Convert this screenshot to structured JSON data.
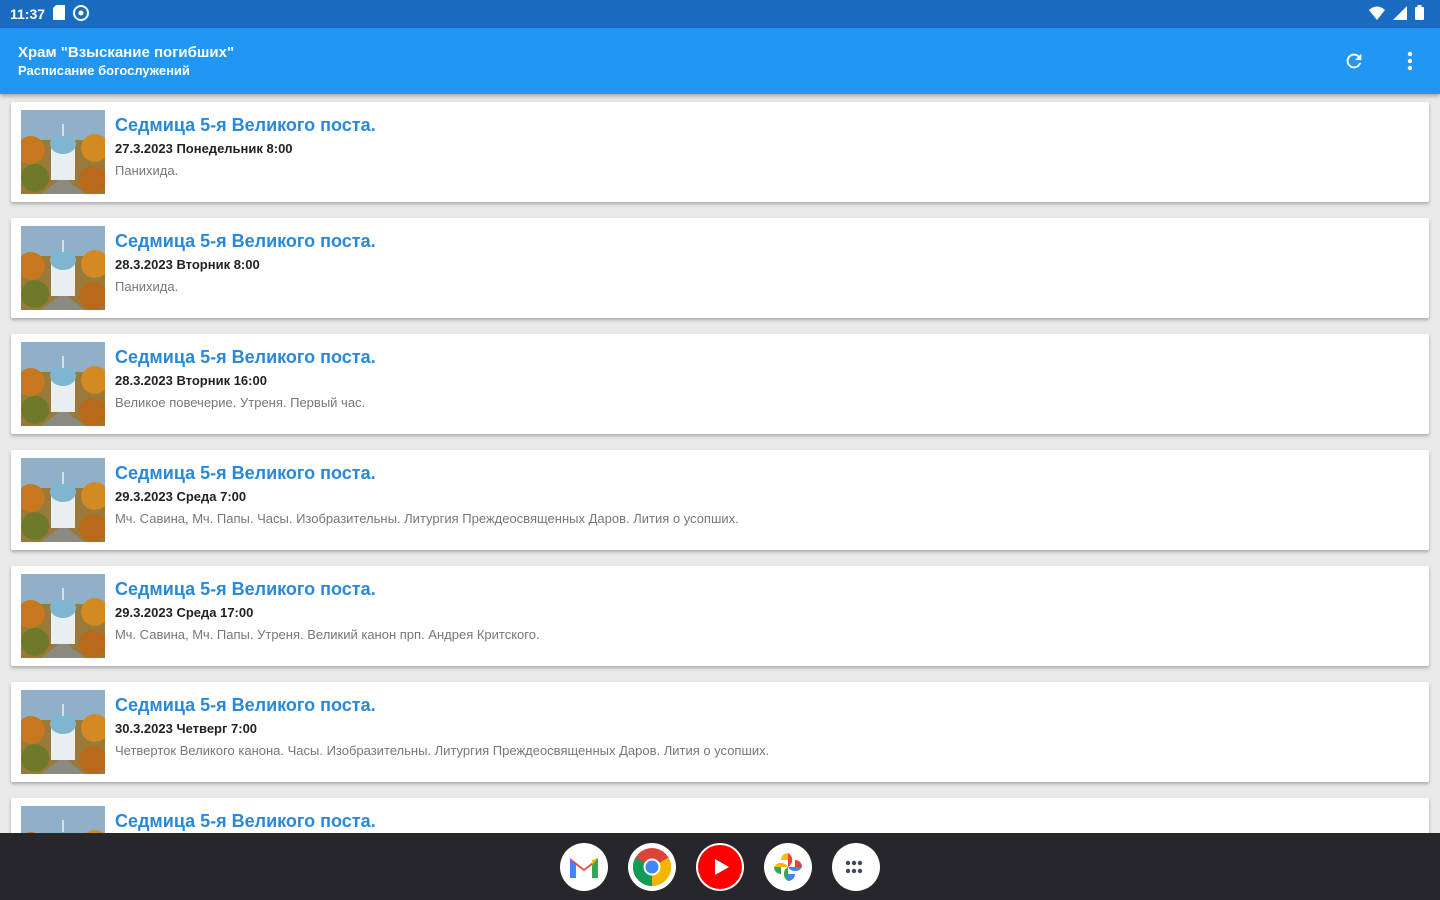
{
  "status_bar": {
    "time": "11:37",
    "icons_left": [
      "sim-card-icon",
      "settings-icon"
    ],
    "icons_right": [
      "wifi-icon",
      "signal-icon",
      "battery-icon"
    ]
  },
  "app_bar": {
    "title": "Храм \"Взыскание погибших\"",
    "subtitle": "Расписание богослужений",
    "actions": [
      "refresh-icon",
      "more-vert-icon"
    ],
    "color": "#2196f3"
  },
  "colors": {
    "status_bar": "#1a6cc0",
    "title_link": "#2a88d8"
  },
  "events": [
    {
      "title": "Седмица 5-я Великого поста.",
      "datetime": "27.3.2023 Понедельник 8:00",
      "description": "Панихида."
    },
    {
      "title": "Седмица 5-я Великого поста.",
      "datetime": "28.3.2023 Вторник 8:00",
      "description": "Панихида."
    },
    {
      "title": "Седмица 5-я Великого поста.",
      "datetime": "28.3.2023 Вторник 16:00",
      "description": "Великое повечерие. Утреня. Первый час."
    },
    {
      "title": "Седмица 5-я Великого поста.",
      "datetime": "29.3.2023 Среда 7:00",
      "description": "Мч. Савина, Мч. Папы. Часы. Изобразительны. Литургия Преждеосвященных Даров. Лития о усопших."
    },
    {
      "title": "Седмица 5-я Великого поста.",
      "datetime": "29.3.2023 Среда 17:00",
      "description": "Мч. Савина, Мч. Папы. Утреня. Великий канон прп. Андрея Критского."
    },
    {
      "title": "Седмица 5-я Великого поста.",
      "datetime": "30.3.2023 Четверг 7:00",
      "description": "Четверток Великого канона. Часы. Изобразительны. Литургия Преждеосвященных Даров. Лития о усопших."
    },
    {
      "title": "Седмица 5-я Великого поста.",
      "datetime": "",
      "description": ""
    }
  ],
  "dock": {
    "apps": [
      "gmail-icon",
      "chrome-icon",
      "youtube-icon",
      "photos-icon",
      "app-drawer-icon"
    ]
  }
}
